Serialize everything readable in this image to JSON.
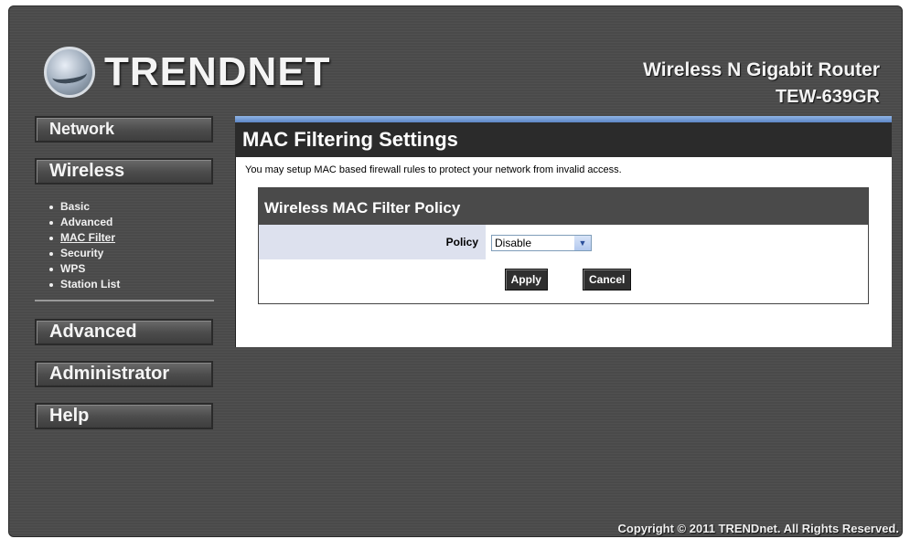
{
  "brand": {
    "logo_text": "TRENDNET"
  },
  "product": {
    "name": "Wireless N Gigabit Router",
    "model": "TEW-639GR"
  },
  "sidebar": {
    "network": "Network",
    "wireless": "Wireless",
    "wireless_items": [
      {
        "label": "Basic"
      },
      {
        "label": "Advanced"
      },
      {
        "label": "MAC Filter",
        "active": true
      },
      {
        "label": "Security"
      },
      {
        "label": "WPS"
      },
      {
        "label": "Station List"
      }
    ],
    "advanced": "Advanced",
    "administrator": "Administrator",
    "help": "Help"
  },
  "main": {
    "title": "MAC Filtering Settings",
    "description": "You may setup MAC based firewall rules to protect your network from invalid access.",
    "policy_section": {
      "header": "Wireless MAC Filter Policy",
      "policy_label": "Policy",
      "policy_value": "Disable",
      "apply": "Apply",
      "cancel": "Cancel"
    }
  },
  "footer": {
    "copyright": "Copyright © 2011 TRENDnet. All Rights Reserved."
  }
}
